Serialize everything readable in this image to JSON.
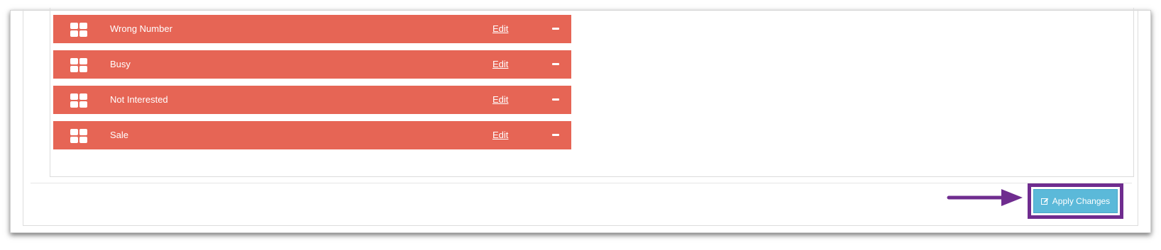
{
  "dispositions": [
    {
      "label": "Wrong Number",
      "edit_label": "Edit"
    },
    {
      "label": "Busy",
      "edit_label": "Edit"
    },
    {
      "label": "Not Interested",
      "edit_label": "Edit"
    },
    {
      "label": "Sale",
      "edit_label": "Edit"
    }
  ],
  "footer": {
    "apply_button_label": "Apply Changes",
    "apply_button_icon": "edit-icon"
  },
  "colors": {
    "row_background": "#e66555",
    "apply_button": "#5bb9d9",
    "annotation_purple": "#6f2c8f"
  },
  "icons": {
    "row_handle": "grid-handle-icon",
    "row_remove": "minus-icon",
    "annotation": "arrow-right-annotation"
  }
}
